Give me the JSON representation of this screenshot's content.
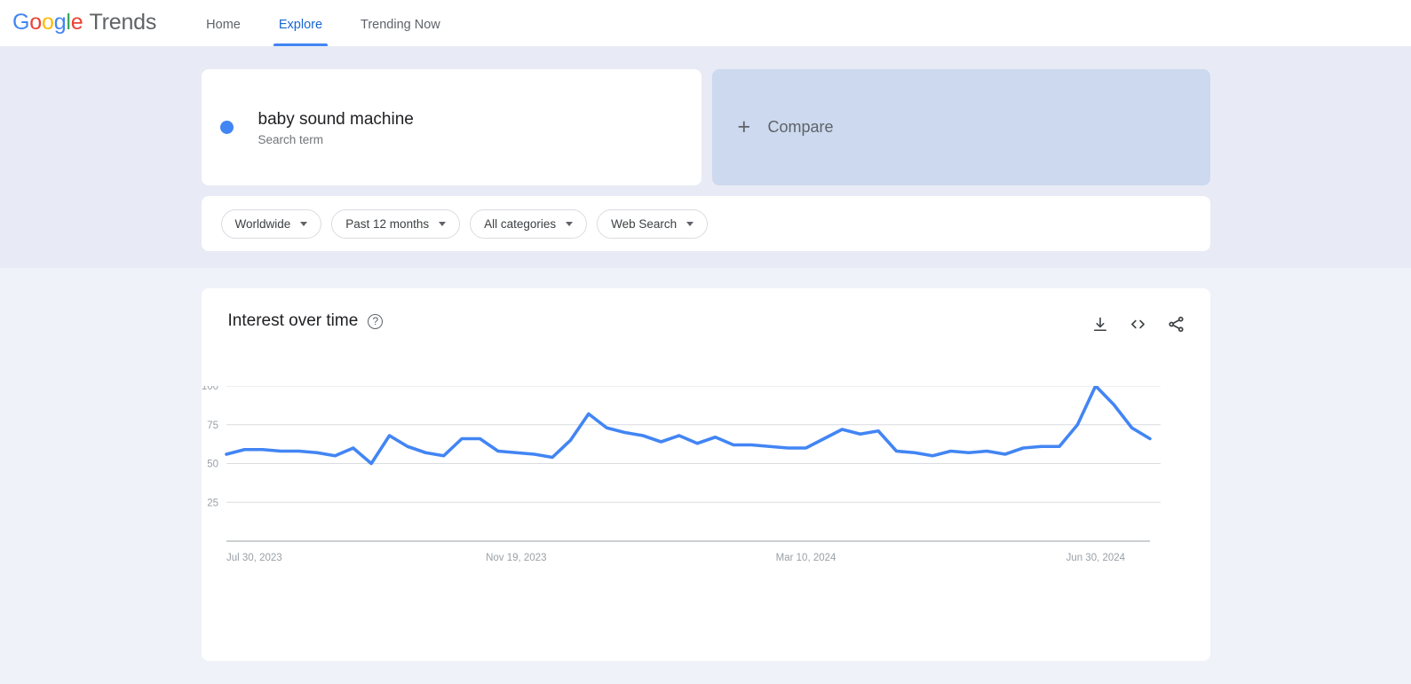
{
  "nav": {
    "brand": {
      "g1": "G",
      "o1": "o",
      "o2": "o",
      "g2": "g",
      "l": "l",
      "e": "e",
      "product": "Trends"
    },
    "links": [
      {
        "label": "Home",
        "active": false
      },
      {
        "label": "Explore",
        "active": true
      },
      {
        "label": "Trending Now",
        "active": false
      }
    ]
  },
  "search": {
    "term": "baby sound machine",
    "type": "Search term",
    "dot_color": "#4285f4",
    "compare_label": "Compare",
    "compare_plus": "+"
  },
  "filters": [
    {
      "label": "Worldwide"
    },
    {
      "label": "Past 12 months"
    },
    {
      "label": "All categories"
    },
    {
      "label": "Web Search"
    }
  ],
  "chart_card": {
    "title": "Interest over time",
    "help_glyph": "?",
    "actions": [
      {
        "name": "download-icon",
        "title": "Download"
      },
      {
        "name": "embed-icon",
        "title": "Embed"
      },
      {
        "name": "share-icon",
        "title": "Share"
      }
    ]
  },
  "chart_data": {
    "type": "line",
    "title": "Interest over time",
    "xlabel": "",
    "ylabel": "",
    "ylim": [
      0,
      100
    ],
    "grid": true,
    "legend_position": "none",
    "line_color": "#4285f4",
    "ytick_labels": [
      "100",
      "75",
      "50",
      "25"
    ],
    "yticks": [
      100,
      75,
      50,
      25
    ],
    "xtick_labels": [
      "Jul 30, 2023",
      "Nov 19, 2023",
      "Mar 10, 2024",
      "Jun 30, 2024"
    ],
    "xtick_index": [
      0,
      16,
      32,
      48
    ],
    "series": [
      {
        "name": "baby sound machine",
        "values": [
          56,
          59,
          59,
          58,
          58,
          57,
          55,
          60,
          50,
          68,
          61,
          57,
          55,
          66,
          66,
          58,
          57,
          56,
          54,
          65,
          82,
          73,
          70,
          68,
          64,
          68,
          63,
          67,
          62,
          62,
          61,
          60,
          60,
          66,
          72,
          69,
          71,
          58,
          57,
          55,
          58,
          57,
          58,
          56,
          60,
          61,
          61,
          75,
          100,
          88,
          73,
          66
        ]
      }
    ]
  }
}
